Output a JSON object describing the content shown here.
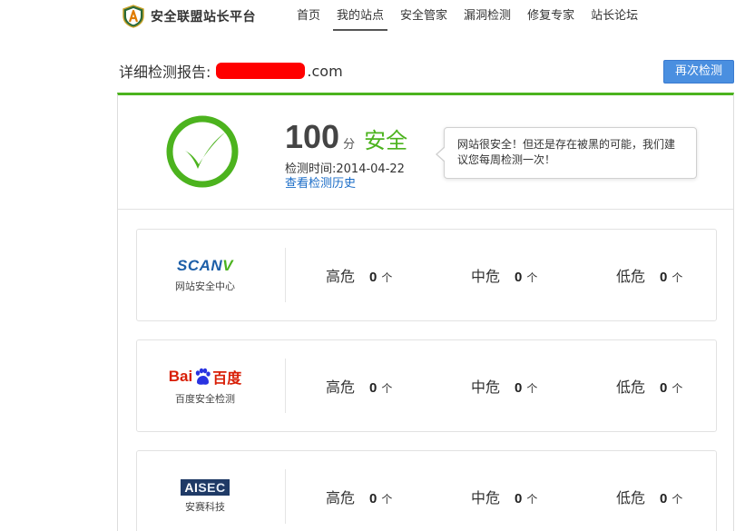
{
  "header": {
    "logo_text": "安全联盟站长平台",
    "nav": [
      {
        "label": "首页",
        "active": false
      },
      {
        "label": "我的站点",
        "active": true
      },
      {
        "label": "安全管家",
        "active": false
      },
      {
        "label": "漏洞检测",
        "active": false
      },
      {
        "label": "修复专家",
        "active": false
      },
      {
        "label": "站长论坛",
        "active": false
      }
    ]
  },
  "report": {
    "title_prefix": "详细检测报告:",
    "domain_suffix": ".com",
    "recheck_button": "再次检测"
  },
  "summary": {
    "score": "100",
    "score_unit": "分",
    "status": "安全",
    "scan_time": "检测时间:2014-04-22",
    "history_link": "查看检测历史",
    "tooltip": "网站很安全！但还是存在被黑的可能，我们建议您每周检测一次！",
    "status_color": "#4cb31e"
  },
  "scanners": [
    {
      "brand_logo": "SCANV",
      "brand_sub": "网站安全中心",
      "risks": [
        {
          "label": "高危",
          "count": "0",
          "unit": "个"
        },
        {
          "label": "中危",
          "count": "0",
          "unit": "个"
        },
        {
          "label": "低危",
          "count": "0",
          "unit": "个"
        }
      ]
    },
    {
      "brand_logo_left": "Bai",
      "brand_logo_right": "百度",
      "brand_sub": "百度安全检测",
      "risks": [
        {
          "label": "高危",
          "count": "0",
          "unit": "个"
        },
        {
          "label": "中危",
          "count": "0",
          "unit": "个"
        },
        {
          "label": "低危",
          "count": "0",
          "unit": "个"
        }
      ]
    },
    {
      "brand_logo_left": "AI",
      "brand_logo_right": "SEC",
      "brand_sub": "安赛科技",
      "risks": [
        {
          "label": "高危",
          "count": "0",
          "unit": "个"
        },
        {
          "label": "中危",
          "count": "0",
          "unit": "个"
        },
        {
          "label": "低危",
          "count": "0",
          "unit": "个"
        }
      ]
    }
  ],
  "colors": {
    "accent_green": "#4cb31e",
    "button_blue": "#4a8fe0",
    "link_blue": "#1a6cc7",
    "redaction": "#ff0000"
  }
}
